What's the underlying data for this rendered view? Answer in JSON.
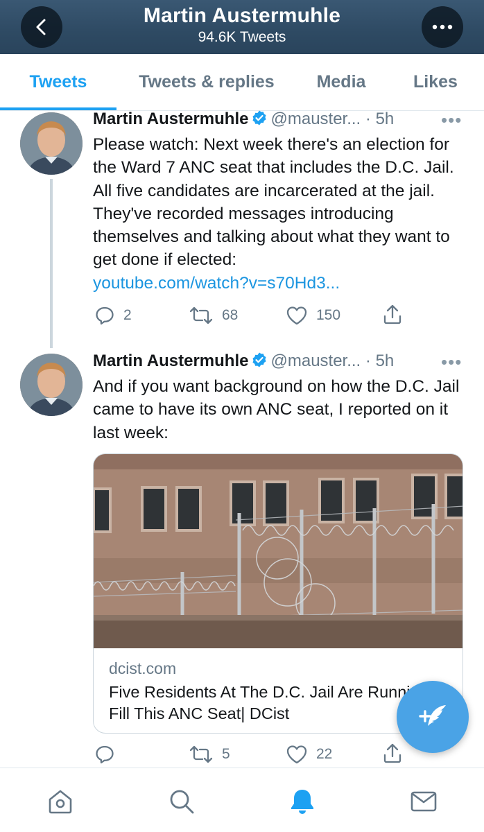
{
  "header": {
    "title": "Martin Austermuhle",
    "subtitle": "94.6K Tweets",
    "back_icon": "chevron-left-icon",
    "more_icon": "more-horizontal-icon"
  },
  "tabs": [
    {
      "label": "Tweets",
      "active": true
    },
    {
      "label": "Tweets & replies",
      "active": false
    },
    {
      "label": "Media",
      "active": false
    },
    {
      "label": "Likes",
      "active": false
    }
  ],
  "tweets": [
    {
      "name": "Martin Austermuhle",
      "handle": "@mauster...",
      "time": "· 5h",
      "text": "Please watch: Next week there's an election for the Ward 7 ANC seat that includes the D.C. Jail. All five candidates are incarcerated at the jail. They've recorded messages introducing themselves and talking about what they want to get done if elected:",
      "link": "youtube.com/watch?v=s70Hd3...",
      "replies": "2",
      "retweets": "68",
      "likes": "150"
    },
    {
      "name": "Martin Austermuhle",
      "handle": "@mauster...",
      "time": "· 5h",
      "text": "And if you want background on how the D.C. Jail came to have its own ANC seat, I reported on it last week:",
      "card": {
        "domain": "dcist.com",
        "title": "Five Residents At The D.C. Jail Are Running To Fill This ANC Seat| DCist"
      },
      "replies": "",
      "retweets": "5",
      "likes": "22"
    }
  ],
  "more_dots": "•••",
  "fab_icon": "compose-tweet-icon",
  "colors": {
    "accent": "#1da1f2",
    "header_bg": "#2e4a63",
    "secondary_text": "#657786",
    "link": "#1b95e0"
  },
  "bottom_nav": [
    {
      "icon": "home-icon",
      "active": false
    },
    {
      "icon": "search-icon",
      "active": false
    },
    {
      "icon": "notifications-bell-icon",
      "active": true
    },
    {
      "icon": "messages-mail-icon",
      "active": false
    }
  ]
}
